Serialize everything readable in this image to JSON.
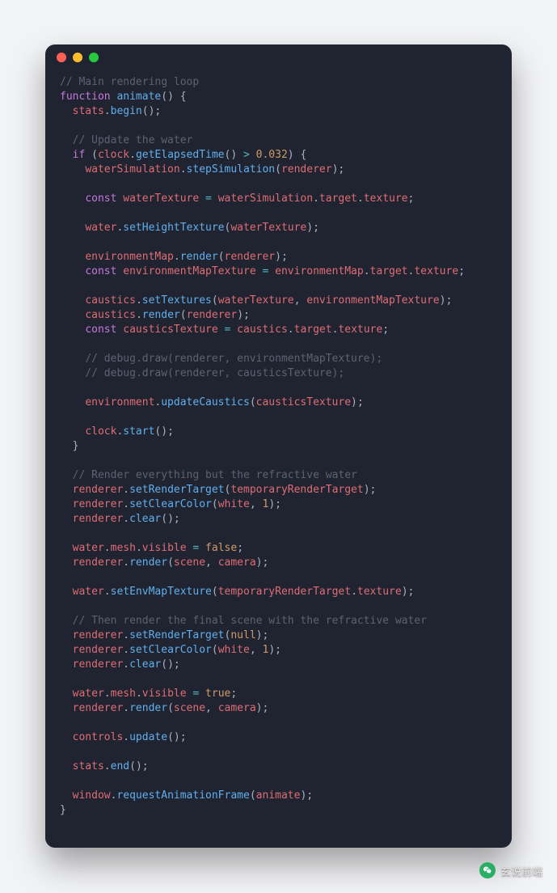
{
  "watermark_text": "玄说前端",
  "code": {
    "tokens": [
      [
        "cmt",
        "// Main rendering loop"
      ],
      [
        "nl"
      ],
      [
        "kw",
        "function"
      ],
      [
        "pn",
        " "
      ],
      [
        "fn",
        "animate"
      ],
      [
        "pn",
        "("
      ],
      [
        "pn",
        ")"
      ],
      [
        "pn",
        " "
      ],
      [
        "pn",
        "{"
      ],
      [
        "nl"
      ],
      [
        "pn",
        "  "
      ],
      [
        "id",
        "stats"
      ],
      [
        "pn",
        "."
      ],
      [
        "fn",
        "begin"
      ],
      [
        "pn",
        "("
      ],
      [
        "pn",
        ")"
      ],
      [
        "pn",
        ";"
      ],
      [
        "nl"
      ],
      [
        "nl"
      ],
      [
        "pn",
        "  "
      ],
      [
        "cmt",
        "// Update the water"
      ],
      [
        "nl"
      ],
      [
        "pn",
        "  "
      ],
      [
        "kw",
        "if"
      ],
      [
        "pn",
        " ("
      ],
      [
        "id",
        "clock"
      ],
      [
        "pn",
        "."
      ],
      [
        "fn",
        "getElapsedTime"
      ],
      [
        "pn",
        "("
      ],
      [
        "pn",
        ")"
      ],
      [
        "pn",
        " "
      ],
      [
        "op",
        ">"
      ],
      [
        "pn",
        " "
      ],
      [
        "num",
        "0.032"
      ],
      [
        "pn",
        ")"
      ],
      [
        "pn",
        " "
      ],
      [
        "pn",
        "{"
      ],
      [
        "nl"
      ],
      [
        "pn",
        "    "
      ],
      [
        "id",
        "waterSimulation"
      ],
      [
        "pn",
        "."
      ],
      [
        "fn",
        "stepSimulation"
      ],
      [
        "pn",
        "("
      ],
      [
        "id",
        "renderer"
      ],
      [
        "pn",
        ")"
      ],
      [
        "pn",
        ";"
      ],
      [
        "nl"
      ],
      [
        "nl"
      ],
      [
        "pn",
        "    "
      ],
      [
        "kw",
        "const"
      ],
      [
        "pn",
        " "
      ],
      [
        "id",
        "waterTexture"
      ],
      [
        "pn",
        " "
      ],
      [
        "op",
        "="
      ],
      [
        "pn",
        " "
      ],
      [
        "id",
        "waterSimulation"
      ],
      [
        "pn",
        "."
      ],
      [
        "id",
        "target"
      ],
      [
        "pn",
        "."
      ],
      [
        "id",
        "texture"
      ],
      [
        "pn",
        ";"
      ],
      [
        "nl"
      ],
      [
        "nl"
      ],
      [
        "pn",
        "    "
      ],
      [
        "id",
        "water"
      ],
      [
        "pn",
        "."
      ],
      [
        "fn",
        "setHeightTexture"
      ],
      [
        "pn",
        "("
      ],
      [
        "id",
        "waterTexture"
      ],
      [
        "pn",
        ")"
      ],
      [
        "pn",
        ";"
      ],
      [
        "nl"
      ],
      [
        "nl"
      ],
      [
        "pn",
        "    "
      ],
      [
        "id",
        "environmentMap"
      ],
      [
        "pn",
        "."
      ],
      [
        "fn",
        "render"
      ],
      [
        "pn",
        "("
      ],
      [
        "id",
        "renderer"
      ],
      [
        "pn",
        ")"
      ],
      [
        "pn",
        ";"
      ],
      [
        "nl"
      ],
      [
        "pn",
        "    "
      ],
      [
        "kw",
        "const"
      ],
      [
        "pn",
        " "
      ],
      [
        "id",
        "environmentMapTexture"
      ],
      [
        "pn",
        " "
      ],
      [
        "op",
        "="
      ],
      [
        "pn",
        " "
      ],
      [
        "id",
        "environmentMap"
      ],
      [
        "pn",
        "."
      ],
      [
        "id",
        "target"
      ],
      [
        "pn",
        "."
      ],
      [
        "id",
        "texture"
      ],
      [
        "pn",
        ";"
      ],
      [
        "nl"
      ],
      [
        "nl"
      ],
      [
        "pn",
        "    "
      ],
      [
        "id",
        "caustics"
      ],
      [
        "pn",
        "."
      ],
      [
        "fn",
        "setTextures"
      ],
      [
        "pn",
        "("
      ],
      [
        "id",
        "waterTexture"
      ],
      [
        "pn",
        ","
      ],
      [
        "pn",
        " "
      ],
      [
        "id",
        "environmentMapTexture"
      ],
      [
        "pn",
        ")"
      ],
      [
        "pn",
        ";"
      ],
      [
        "nl"
      ],
      [
        "pn",
        "    "
      ],
      [
        "id",
        "caustics"
      ],
      [
        "pn",
        "."
      ],
      [
        "fn",
        "render"
      ],
      [
        "pn",
        "("
      ],
      [
        "id",
        "renderer"
      ],
      [
        "pn",
        ")"
      ],
      [
        "pn",
        ";"
      ],
      [
        "nl"
      ],
      [
        "pn",
        "    "
      ],
      [
        "kw",
        "const"
      ],
      [
        "pn",
        " "
      ],
      [
        "id",
        "causticsTexture"
      ],
      [
        "pn",
        " "
      ],
      [
        "op",
        "="
      ],
      [
        "pn",
        " "
      ],
      [
        "id",
        "caustics"
      ],
      [
        "pn",
        "."
      ],
      [
        "id",
        "target"
      ],
      [
        "pn",
        "."
      ],
      [
        "id",
        "texture"
      ],
      [
        "pn",
        ";"
      ],
      [
        "nl"
      ],
      [
        "nl"
      ],
      [
        "pn",
        "    "
      ],
      [
        "cmt",
        "// debug.draw(renderer, environmentMapTexture);"
      ],
      [
        "nl"
      ],
      [
        "pn",
        "    "
      ],
      [
        "cmt",
        "// debug.draw(renderer, causticsTexture);"
      ],
      [
        "nl"
      ],
      [
        "nl"
      ],
      [
        "pn",
        "    "
      ],
      [
        "id",
        "environment"
      ],
      [
        "pn",
        "."
      ],
      [
        "fn",
        "updateCaustics"
      ],
      [
        "pn",
        "("
      ],
      [
        "id",
        "causticsTexture"
      ],
      [
        "pn",
        ")"
      ],
      [
        "pn",
        ";"
      ],
      [
        "nl"
      ],
      [
        "nl"
      ],
      [
        "pn",
        "    "
      ],
      [
        "id",
        "clock"
      ],
      [
        "pn",
        "."
      ],
      [
        "fn",
        "start"
      ],
      [
        "pn",
        "("
      ],
      [
        "pn",
        ")"
      ],
      [
        "pn",
        ";"
      ],
      [
        "nl"
      ],
      [
        "pn",
        "  "
      ],
      [
        "pn",
        "}"
      ],
      [
        "nl"
      ],
      [
        "nl"
      ],
      [
        "pn",
        "  "
      ],
      [
        "cmt",
        "// Render everything but the refractive water"
      ],
      [
        "nl"
      ],
      [
        "pn",
        "  "
      ],
      [
        "id",
        "renderer"
      ],
      [
        "pn",
        "."
      ],
      [
        "fn",
        "setRenderTarget"
      ],
      [
        "pn",
        "("
      ],
      [
        "id",
        "temporaryRenderTarget"
      ],
      [
        "pn",
        ")"
      ],
      [
        "pn",
        ";"
      ],
      [
        "nl"
      ],
      [
        "pn",
        "  "
      ],
      [
        "id",
        "renderer"
      ],
      [
        "pn",
        "."
      ],
      [
        "fn",
        "setClearColor"
      ],
      [
        "pn",
        "("
      ],
      [
        "id",
        "white"
      ],
      [
        "pn",
        ","
      ],
      [
        "pn",
        " "
      ],
      [
        "num",
        "1"
      ],
      [
        "pn",
        ")"
      ],
      [
        "pn",
        ";"
      ],
      [
        "nl"
      ],
      [
        "pn",
        "  "
      ],
      [
        "id",
        "renderer"
      ],
      [
        "pn",
        "."
      ],
      [
        "fn",
        "clear"
      ],
      [
        "pn",
        "("
      ],
      [
        "pn",
        ")"
      ],
      [
        "pn",
        ";"
      ],
      [
        "nl"
      ],
      [
        "nl"
      ],
      [
        "pn",
        "  "
      ],
      [
        "id",
        "water"
      ],
      [
        "pn",
        "."
      ],
      [
        "id",
        "mesh"
      ],
      [
        "pn",
        "."
      ],
      [
        "id",
        "visible"
      ],
      [
        "pn",
        " "
      ],
      [
        "op",
        "="
      ],
      [
        "pn",
        " "
      ],
      [
        "num",
        "false"
      ],
      [
        "pn",
        ";"
      ],
      [
        "nl"
      ],
      [
        "pn",
        "  "
      ],
      [
        "id",
        "renderer"
      ],
      [
        "pn",
        "."
      ],
      [
        "fn",
        "render"
      ],
      [
        "pn",
        "("
      ],
      [
        "id",
        "scene"
      ],
      [
        "pn",
        ","
      ],
      [
        "pn",
        " "
      ],
      [
        "id",
        "camera"
      ],
      [
        "pn",
        ")"
      ],
      [
        "pn",
        ";"
      ],
      [
        "nl"
      ],
      [
        "nl"
      ],
      [
        "pn",
        "  "
      ],
      [
        "id",
        "water"
      ],
      [
        "pn",
        "."
      ],
      [
        "fn",
        "setEnvMapTexture"
      ],
      [
        "pn",
        "("
      ],
      [
        "id",
        "temporaryRenderTarget"
      ],
      [
        "pn",
        "."
      ],
      [
        "id",
        "texture"
      ],
      [
        "pn",
        ")"
      ],
      [
        "pn",
        ";"
      ],
      [
        "nl"
      ],
      [
        "nl"
      ],
      [
        "pn",
        "  "
      ],
      [
        "cmt",
        "// Then render the final scene with the refractive water"
      ],
      [
        "nl"
      ],
      [
        "pn",
        "  "
      ],
      [
        "id",
        "renderer"
      ],
      [
        "pn",
        "."
      ],
      [
        "fn",
        "setRenderTarget"
      ],
      [
        "pn",
        "("
      ],
      [
        "num",
        "null"
      ],
      [
        "pn",
        ")"
      ],
      [
        "pn",
        ";"
      ],
      [
        "nl"
      ],
      [
        "pn",
        "  "
      ],
      [
        "id",
        "renderer"
      ],
      [
        "pn",
        "."
      ],
      [
        "fn",
        "setClearColor"
      ],
      [
        "pn",
        "("
      ],
      [
        "id",
        "white"
      ],
      [
        "pn",
        ","
      ],
      [
        "pn",
        " "
      ],
      [
        "num",
        "1"
      ],
      [
        "pn",
        ")"
      ],
      [
        "pn",
        ";"
      ],
      [
        "nl"
      ],
      [
        "pn",
        "  "
      ],
      [
        "id",
        "renderer"
      ],
      [
        "pn",
        "."
      ],
      [
        "fn",
        "clear"
      ],
      [
        "pn",
        "("
      ],
      [
        "pn",
        ")"
      ],
      [
        "pn",
        ";"
      ],
      [
        "nl"
      ],
      [
        "nl"
      ],
      [
        "pn",
        "  "
      ],
      [
        "id",
        "water"
      ],
      [
        "pn",
        "."
      ],
      [
        "id",
        "mesh"
      ],
      [
        "pn",
        "."
      ],
      [
        "id",
        "visible"
      ],
      [
        "pn",
        " "
      ],
      [
        "op",
        "="
      ],
      [
        "pn",
        " "
      ],
      [
        "num",
        "true"
      ],
      [
        "pn",
        ";"
      ],
      [
        "nl"
      ],
      [
        "pn",
        "  "
      ],
      [
        "id",
        "renderer"
      ],
      [
        "pn",
        "."
      ],
      [
        "fn",
        "render"
      ],
      [
        "pn",
        "("
      ],
      [
        "id",
        "scene"
      ],
      [
        "pn",
        ","
      ],
      [
        "pn",
        " "
      ],
      [
        "id",
        "camera"
      ],
      [
        "pn",
        ")"
      ],
      [
        "pn",
        ";"
      ],
      [
        "nl"
      ],
      [
        "nl"
      ],
      [
        "pn",
        "  "
      ],
      [
        "id",
        "controls"
      ],
      [
        "pn",
        "."
      ],
      [
        "fn",
        "update"
      ],
      [
        "pn",
        "("
      ],
      [
        "pn",
        ")"
      ],
      [
        "pn",
        ";"
      ],
      [
        "nl"
      ],
      [
        "nl"
      ],
      [
        "pn",
        "  "
      ],
      [
        "id",
        "stats"
      ],
      [
        "pn",
        "."
      ],
      [
        "fn",
        "end"
      ],
      [
        "pn",
        "("
      ],
      [
        "pn",
        ")"
      ],
      [
        "pn",
        ";"
      ],
      [
        "nl"
      ],
      [
        "nl"
      ],
      [
        "pn",
        "  "
      ],
      [
        "id",
        "window"
      ],
      [
        "pn",
        "."
      ],
      [
        "fn",
        "requestAnimationFrame"
      ],
      [
        "pn",
        "("
      ],
      [
        "id",
        "animate"
      ],
      [
        "pn",
        ")"
      ],
      [
        "pn",
        ";"
      ],
      [
        "nl"
      ],
      [
        "pn",
        "}"
      ]
    ]
  }
}
